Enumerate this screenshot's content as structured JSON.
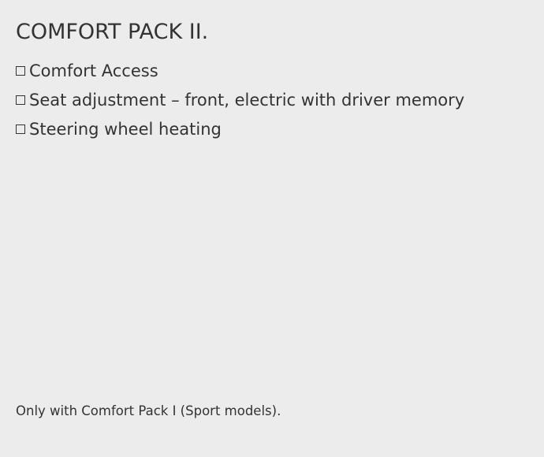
{
  "pack": {
    "title": "COMFORT PACK II.",
    "features": [
      {
        "label": "Comfort Access",
        "checked": false
      },
      {
        "label": "Seat adjustment – front, electric with driver memory",
        "checked": false
      },
      {
        "label": "Steering wheel heating",
        "checked": false
      }
    ],
    "footnote": "Only with Comfort Pack I (Sport models)."
  },
  "colors": {
    "background": "#ececec",
    "text": "#333333"
  },
  "icons": {
    "checkbox": "checkbox-empty-icon"
  }
}
